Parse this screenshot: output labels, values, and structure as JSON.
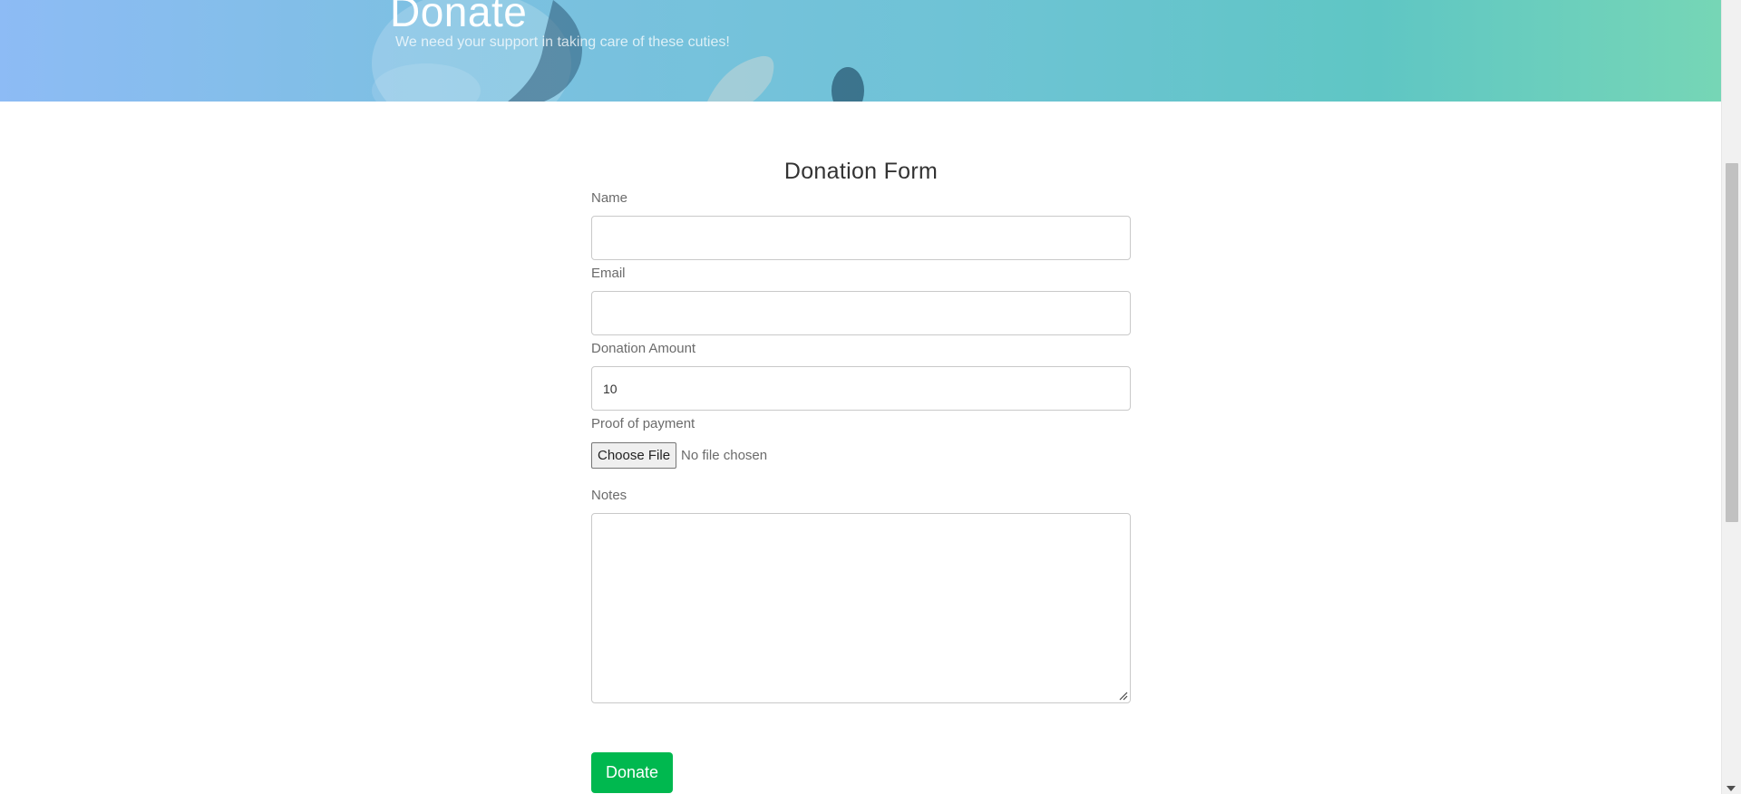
{
  "hero": {
    "title": "Donate",
    "subtitle": "We need your support in taking care of these cuties!"
  },
  "form": {
    "title": "Donation Form",
    "name_label": "Name",
    "name_value": "",
    "email_label": "Email",
    "email_value": "",
    "amount_label": "Donation Amount",
    "amount_value": "10",
    "proof_label": "Proof of payment",
    "file_button_label": "Choose File",
    "file_status": "No file chosen",
    "notes_label": "Notes",
    "notes_value": "",
    "submit_label": "Donate"
  },
  "colors": {
    "submit_button": "#00b84f",
    "hero_gradient_start": "#8dbbf5",
    "hero_gradient_end": "#76d6b6"
  }
}
